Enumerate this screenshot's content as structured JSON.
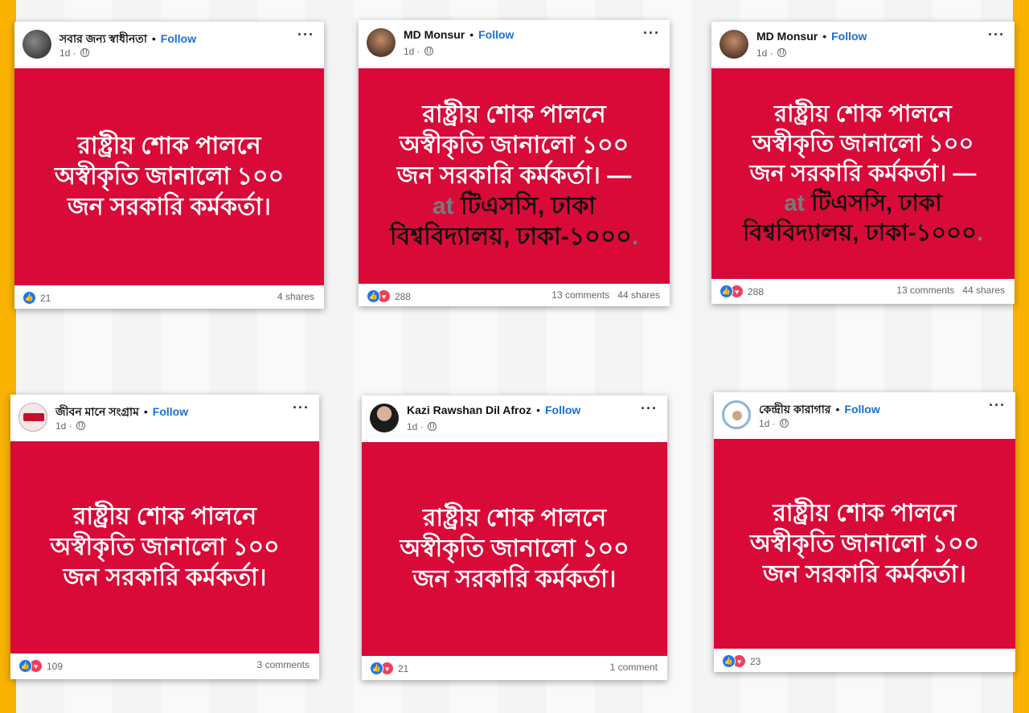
{
  "posts": [
    {
      "page_name": "সবার জন্য স্বাধীনতা",
      "separator": "•",
      "follow": "Follow",
      "time": "1d ·",
      "more": "···",
      "body_lines": [
        "রাষ্ট্রীয় শোক পালনে",
        "অস্বীকৃতি জানালো ১০০",
        "জন সরকারি কর্মকর্তা।"
      ],
      "reaction_count": "21",
      "comments": "",
      "shares": "4 shares"
    },
    {
      "page_name": "MD Monsur",
      "separator": "•",
      "follow": "Follow",
      "time": "1d ·",
      "more": "···",
      "body_lines": [
        "রাষ্ট্রীয় শোক পালনে",
        "অস্বীকৃতি জানালো ১০০",
        "জন সরকারি কর্মকর্তা। —"
      ],
      "at_prefix": "at",
      "location_line1": " টিএসসি, ঢাকা",
      "location_line2": "বিশ্ববিদ্যালয়, ঢাকা-১০০০",
      "period": ".",
      "reaction_count": "288",
      "comments": "13 comments",
      "shares": "44 shares"
    },
    {
      "page_name": "MD Monsur",
      "separator": "•",
      "follow": "Follow",
      "time": "1d ·",
      "more": "···",
      "body_lines": [
        "রাষ্ট্রীয় শোক পালনে",
        "অস্বীকৃতি জানালো ১০০",
        "জন সরকারি কর্মকর্তা। —"
      ],
      "at_prefix": "at",
      "location_line1": " টিএসসি, ঢাকা",
      "location_line2": "বিশ্ববিদ্যালয়, ঢাকা-১০০০",
      "period": ".",
      "reaction_count": "288",
      "comments": "13 comments",
      "shares": "44 shares"
    },
    {
      "page_name": "জীবন মানে সংগ্রাম",
      "separator": "•",
      "follow": "Follow",
      "time": "1d ·",
      "more": "···",
      "body_lines": [
        "রাষ্ট্রীয় শোক পালনে",
        "অস্বীকৃতি জানালো ১০০",
        "জন সরকারি কর্মকর্তা।"
      ],
      "reaction_count": "109",
      "comments": "3 comments",
      "shares": ""
    },
    {
      "page_name": "Kazi Rawshan Dil Afroz",
      "separator": "•",
      "follow": "Follow",
      "time": "1d ·",
      "more": "···",
      "body_lines": [
        "রাষ্ট্রীয় শোক পালনে",
        "অস্বীকৃতি জানালো ১০০",
        "জন সরকারি কর্মকর্তা।"
      ],
      "reaction_count": "21",
      "comments": "1 comment",
      "shares": ""
    },
    {
      "page_name": "কেন্দ্রীয় কারাগার",
      "separator": "•",
      "follow": "Follow",
      "time": "1d ·",
      "more": "···",
      "body_lines": [
        "রাষ্ট্রীয় শোক পালনে",
        "অস্বীকৃতি জানালো ১০০",
        "জন সরকারি কর্মকর্তা।"
      ],
      "reaction_count": "23",
      "comments": "",
      "shares": ""
    }
  ],
  "icons": {
    "like": "like-reaction-icon",
    "love": "love-reaction-icon",
    "globe": "globe-icon",
    "more": "more-options-icon"
  },
  "colors": {
    "post_background": "#d90a37",
    "follow": "#1a6fd6",
    "frame": "#f9b200"
  }
}
